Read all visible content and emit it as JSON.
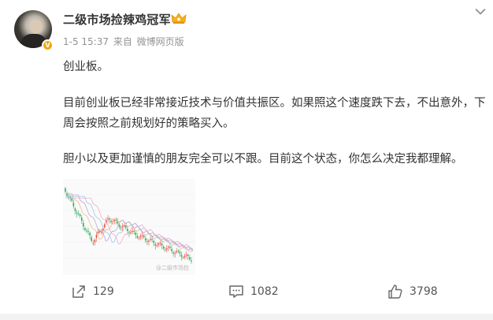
{
  "post": {
    "username": "二级市场捡辣鸡冠军",
    "timestamp": "1-5 15:37",
    "source_prefix": "来自",
    "source": "微博网页版",
    "paragraphs": [
      "创业板。",
      "目前创业板已经非常接近技术与价值共振区。如果照这个速度跌下去，不出意外，下周会按照之前规划好的策略买入。",
      "胆小以及更加谨慎的朋友完全可以不跟。目前这个状态，你怎么决定我都理解。"
    ],
    "image": {
      "watermark": "@二级市场捡",
      "icon": "candlestick-chart-image"
    }
  },
  "actions": {
    "repost_count": "129",
    "comment_count": "1082",
    "like_count": "3798"
  },
  "icons": {
    "verified": "verified-badge-icon",
    "crown": "crown-icon",
    "dropdown": "chevron-down-icon",
    "repost": "share-icon",
    "comment": "comment-icon",
    "like": "thumbs-up-icon"
  },
  "colors": {
    "verified_badge": "#f2a80f",
    "meta_text": "#939393",
    "chart_red": "#e74c3c",
    "chart_green": "#2eaa5b"
  }
}
